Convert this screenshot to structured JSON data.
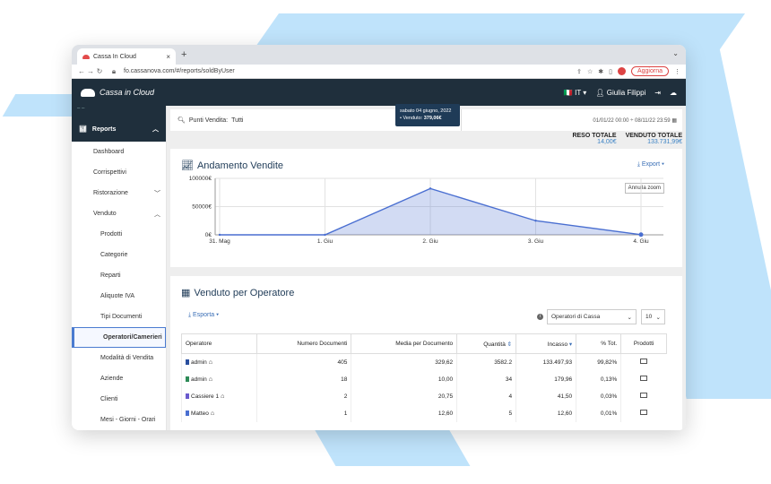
{
  "browser": {
    "tab_title": "Cassa In Cloud",
    "tab_close": "×",
    "new_tab": "+",
    "url": "fo.cassanova.com/#/reports/soldByUser",
    "update_button": "Aggiorna",
    "avatar_initial": "F"
  },
  "app": {
    "brand": "Cassa in Cloud",
    "language": "IT",
    "user": "Giulia Filippi"
  },
  "sidebar": {
    "section": "Reports",
    "items": [
      {
        "label": "Dashboard",
        "level": 1
      },
      {
        "label": "Corrispettivi",
        "level": 1
      },
      {
        "label": "Ristorazione",
        "level": 1,
        "chevron": "down"
      },
      {
        "label": "Venduto",
        "level": 1,
        "chevron": "up"
      },
      {
        "label": "Prodotti",
        "level": 2
      },
      {
        "label": "Categorie",
        "level": 2
      },
      {
        "label": "Reparti",
        "level": 2
      },
      {
        "label": "Aliquote IVA",
        "level": 2
      },
      {
        "label": "Tipi Documenti",
        "level": 2
      },
      {
        "label": "Operatori/Camerieri",
        "level": 2,
        "active": true
      },
      {
        "label": "Modalità di Vendita",
        "level": 2
      },
      {
        "label": "Aziende",
        "level": 2
      },
      {
        "label": "Clienti",
        "level": 2
      },
      {
        "label": "Mesi - Giorni - Orari",
        "level": 2
      }
    ]
  },
  "filter": {
    "points_label": "Punti Vendita:",
    "points_value": "Tutti",
    "date_range": "01/01/22 00:00 ÷ 08/11/22 23:59"
  },
  "totals": {
    "reso_label": "RESO TOTALE",
    "reso_value": "14,00€",
    "venduto_label": "VENDUTO TOTALE",
    "venduto_value": "133.731,99€"
  },
  "chart_card": {
    "title": "Andamento Vendite",
    "export": "Export",
    "reset_zoom": "Annulla zoom",
    "tooltip_date": "sabato 04 giugno, 2022",
    "tooltip_series": "Venduto:",
    "tooltip_value": "379,06€"
  },
  "chart_data": {
    "type": "area",
    "title": "Andamento Vendite",
    "x": [
      "31. Mag",
      "1. Giu",
      "2. Giu",
      "3. Giu",
      "4. Giu"
    ],
    "values": [
      0,
      0,
      82000,
      25000,
      379.06
    ],
    "yticks": [
      "100000€",
      "50000€",
      "0€"
    ],
    "ylim": [
      0,
      100000
    ],
    "grid": true,
    "color": "#4a6fd1"
  },
  "table_card": {
    "title": "Venduto per Operatore",
    "export": "Esporta",
    "info_icon": "i",
    "select_value": "Operatori di Cassa",
    "page_size": "10",
    "columns": [
      "Operatore",
      "Numero Documenti",
      "Media per Documento",
      "Quantità",
      "Incasso",
      "% Tot.",
      "Prodotti"
    ],
    "rows": [
      {
        "name": "admin",
        "color": "#2a4f9e",
        "docs": "405",
        "avg": "329,62",
        "qty": "3582.2",
        "income": "133.497,93",
        "pct": "99,82%"
      },
      {
        "name": "admin",
        "color": "#2e8b57",
        "docs": "18",
        "avg": "10,00",
        "qty": "34",
        "income": "179,96",
        "pct": "0,13%"
      },
      {
        "name": "Cassiere 1",
        "color": "#6a5acd",
        "docs": "2",
        "avg": "20,75",
        "qty": "4",
        "income": "41,50",
        "pct": "0,03%"
      },
      {
        "name": "Matteo",
        "color": "#4a6fd1",
        "docs": "1",
        "avg": "12,60",
        "qty": "5",
        "income": "12,60",
        "pct": "0,01%"
      }
    ]
  }
}
